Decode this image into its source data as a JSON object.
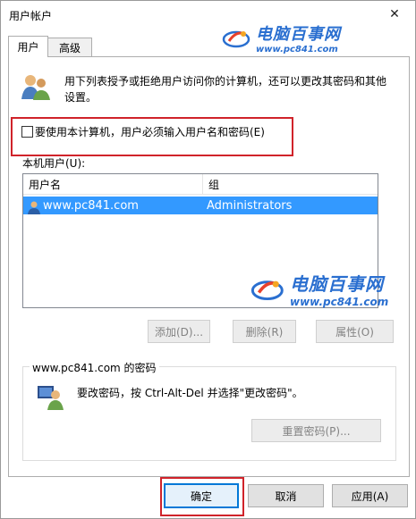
{
  "window": {
    "title": "用户帐户"
  },
  "watermark": {
    "cn": "电脑百事网",
    "url": "www.pc841.com"
  },
  "tabs": [
    {
      "label": "用户"
    },
    {
      "label": "高级"
    }
  ],
  "info": {
    "text": "用下列表授予或拒绝用户访问你的计算机，还可以更改其密码和其他设置。"
  },
  "require_password": {
    "label": "要使用本计算机，用户必须输入用户名和密码(E)",
    "checked": false
  },
  "users": {
    "label": "本机用户(U):",
    "columns": [
      "用户名",
      "组"
    ],
    "rows": [
      {
        "name": "www.pc841.com",
        "group": "Administrators"
      }
    ]
  },
  "user_buttons": {
    "add": "添加(D)...",
    "delete": "删除(R)",
    "properties": "属性(O)"
  },
  "password_group": {
    "title": "www.pc841.com 的密码",
    "text": "要改密码，按 Ctrl-Alt-Del 并选择\"更改密码\"。",
    "reset_button": "重置密码(P)..."
  },
  "dialog_buttons": {
    "ok": "确定",
    "cancel": "取消",
    "apply": "应用(A)"
  },
  "colors": {
    "selection": "#3399ff",
    "highlight_border": "#d0232a",
    "watermark": "#2a6fd0"
  }
}
